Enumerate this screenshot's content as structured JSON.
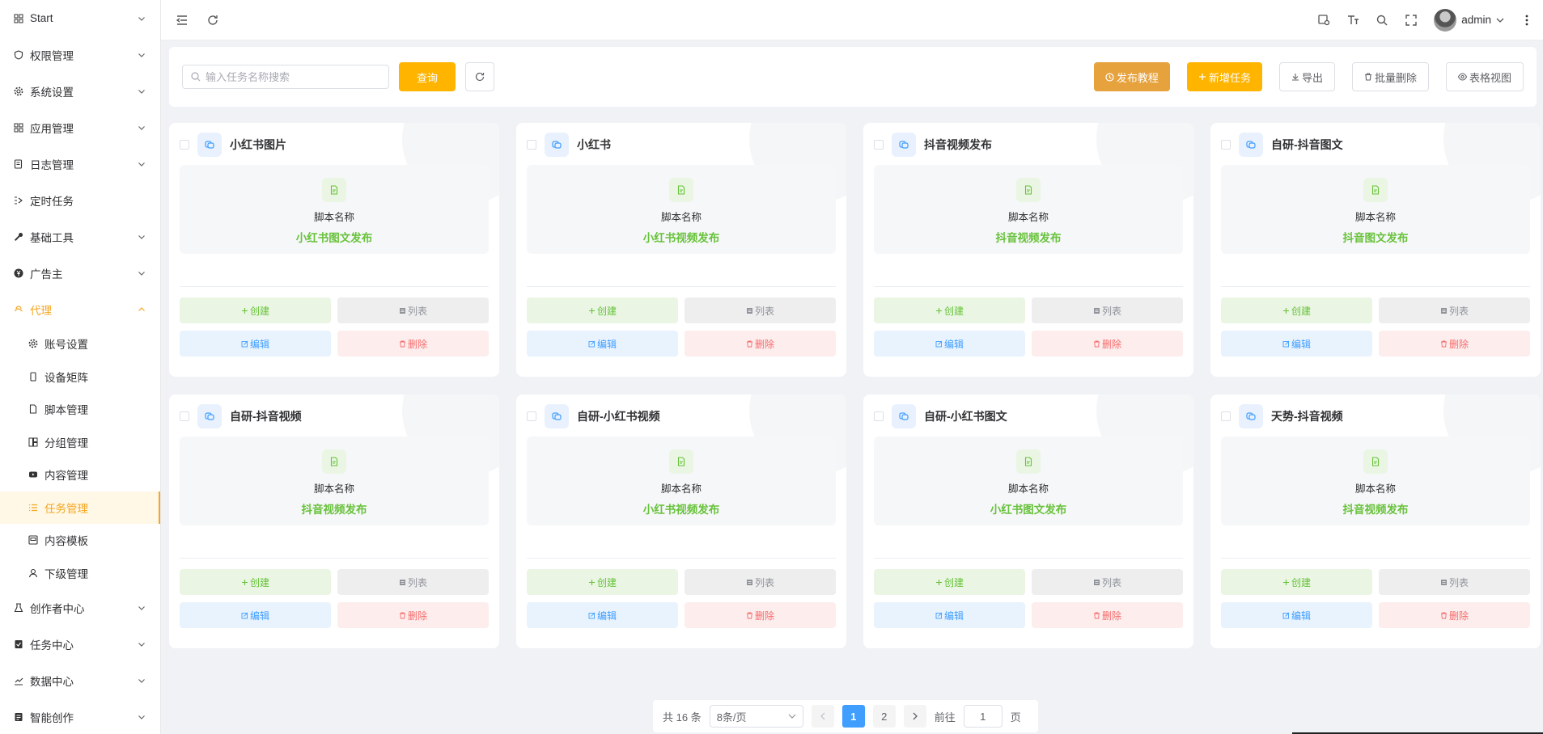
{
  "sidebar": {
    "items": [
      {
        "label": "Start",
        "icon": "grid-icon",
        "chevron": "down"
      },
      {
        "label": "权限管理",
        "icon": "shield-icon",
        "chevron": "down"
      },
      {
        "label": "系统设置",
        "icon": "gear-icon",
        "chevron": "down"
      },
      {
        "label": "应用管理",
        "icon": "grid-icon",
        "chevron": "down"
      },
      {
        "label": "日志管理",
        "icon": "log-icon",
        "chevron": "down"
      },
      {
        "label": "定时任务",
        "icon": "timer-icon",
        "chevron": ""
      },
      {
        "label": "基础工具",
        "icon": "wrench-icon",
        "chevron": "down"
      },
      {
        "label": "广告主",
        "icon": "yen-icon",
        "chevron": "down"
      }
    ],
    "open_group": {
      "label": "代理",
      "icon": "agent-icon",
      "children": [
        {
          "label": "账号设置",
          "icon": "gear-icon"
        },
        {
          "label": "设备矩阵",
          "icon": "phone-icon"
        },
        {
          "label": "脚本管理",
          "icon": "doc-icon"
        },
        {
          "label": "分组管理",
          "icon": "group-icon"
        },
        {
          "label": "内容管理",
          "icon": "video-icon"
        },
        {
          "label": "任务管理",
          "icon": "list-icon",
          "active": true
        },
        {
          "label": "内容模板",
          "icon": "template-icon"
        },
        {
          "label": "下级管理",
          "icon": "user-icon"
        }
      ]
    },
    "after_items": [
      {
        "label": "创作者中心",
        "icon": "creator-icon"
      },
      {
        "label": "任务中心",
        "icon": "task-center-icon"
      },
      {
        "label": "数据中心",
        "icon": "chart-icon"
      },
      {
        "label": "智能创作",
        "icon": "ai-icon"
      }
    ]
  },
  "topbar": {
    "username": "admin"
  },
  "search": {
    "placeholder": "输入任务名称搜索",
    "query_label": "查询"
  },
  "toolbar": {
    "tutorial_label": "发布教程",
    "add_label": "新增任务",
    "export_label": "导出",
    "batch_delete_label": "批量删除",
    "table_view_label": "表格视图"
  },
  "card_labels": {
    "script_label": "脚本名称",
    "create": "创建",
    "list": "列表",
    "edit": "编辑",
    "delete": "删除"
  },
  "tasks": [
    {
      "title": "小红书图片",
      "script": "小红书图文发布"
    },
    {
      "title": "小红书",
      "script": "小红书视频发布"
    },
    {
      "title": "抖音视频发布",
      "script": "抖音视频发布"
    },
    {
      "title": "自研-抖音图文",
      "script": "抖音图文发布"
    },
    {
      "title": "自研-抖音视频",
      "script": "抖音视频发布"
    },
    {
      "title": "自研-小红书视频",
      "script": "小红书视频发布"
    },
    {
      "title": "自研-小红书图文",
      "script": "小红书图文发布"
    },
    {
      "title": "天势-抖音视频",
      "script": "抖音视频发布"
    }
  ],
  "pagination": {
    "total_text": "共 16 条",
    "page_size": "8条/页",
    "pages": [
      "1",
      "2"
    ],
    "current": "1",
    "goto_prefix": "前往",
    "goto_value": "1",
    "goto_suffix": "页"
  },
  "colors": {
    "accent": "#ffb400",
    "tutorial": "#e6a23c",
    "success": "#67c23a",
    "primary": "#409eff",
    "danger": "#f56c6c"
  }
}
